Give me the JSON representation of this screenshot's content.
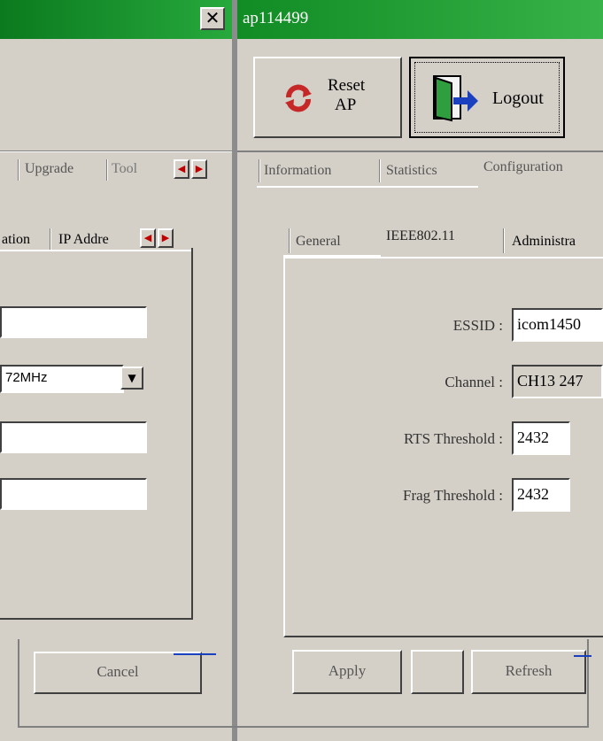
{
  "left_window": {
    "tabs": [
      "Upgrade",
      "Tool"
    ],
    "subtabs": [
      "ation",
      "IP Addre"
    ],
    "fields": {
      "field1_value": "",
      "channel_value": "72MHz",
      "field3_value": "",
      "field4_value": ""
    },
    "cancel_label": "Cancel"
  },
  "right_window": {
    "title": "ap114499",
    "reset_label_line1": "Reset",
    "reset_label_line2": "AP",
    "logout_label": "Logout",
    "tabs": [
      "Information",
      "Statistics",
      "Configuration"
    ],
    "subtabs": [
      "General",
      "IEEE802.11",
      "Administra"
    ],
    "form": {
      "essid_label": "ESSID :",
      "essid_value": "icom1450",
      "channel_label": "Channel :",
      "channel_value": "CH13 247",
      "rts_label": "RTS Threshold :",
      "rts_value": "2432",
      "frag_label": "Frag Threshold :",
      "frag_value": "2432"
    },
    "apply_label": "Apply",
    "refresh_label": "Refresh"
  },
  "colors": {
    "titlebar": "#1a8f2b",
    "face": "#d4d0c8",
    "shadow": "#404040"
  },
  "icons": {
    "close": "close-icon",
    "reset": "reset-icon",
    "logout": "logout-door-icon",
    "arrow_left": "arrow-left-icon",
    "arrow_right": "arrow-right-icon",
    "dropdown": "dropdown-arrow-icon"
  }
}
